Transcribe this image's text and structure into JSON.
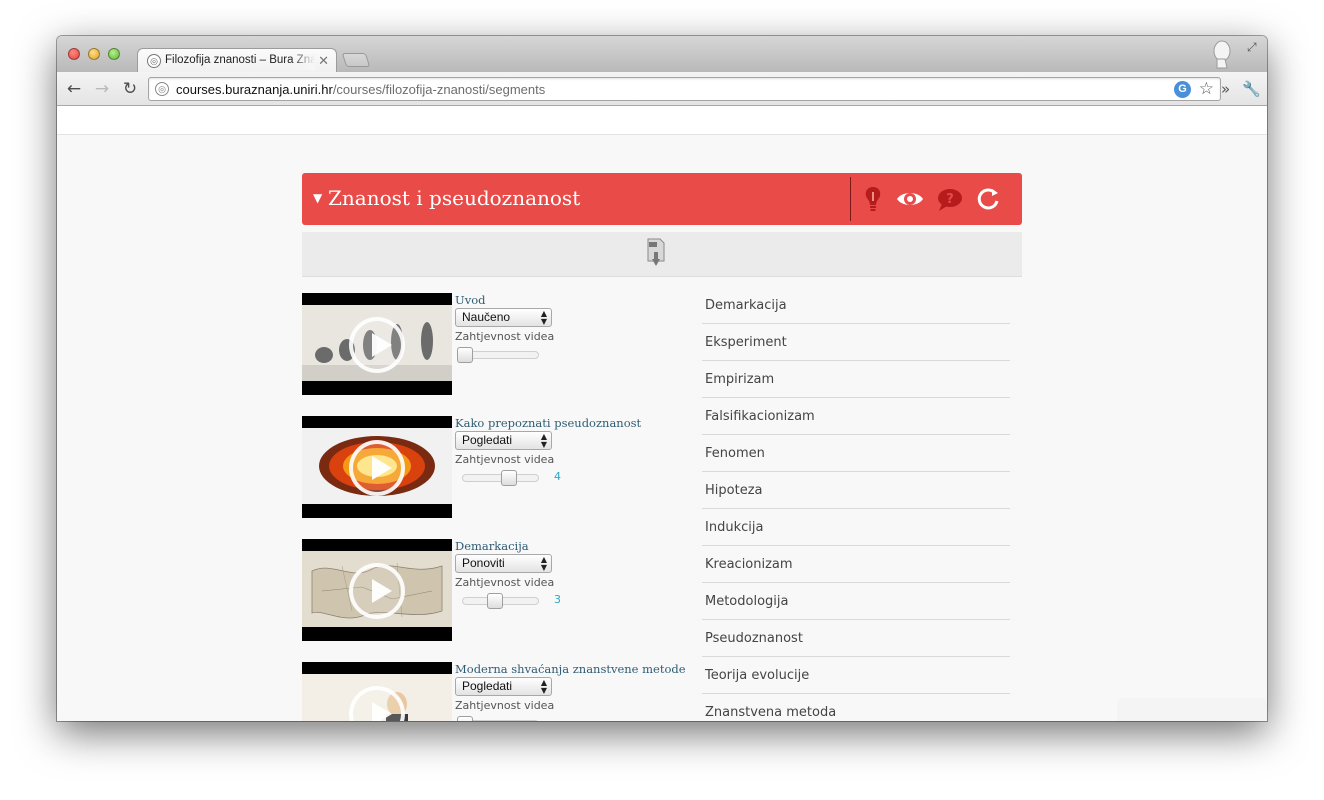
{
  "browser": {
    "tab_title": "Filozofija znanosti – Bura Znanja",
    "url_host": "courses.buraznanja.uniri.hr",
    "url_path": "/courses/filozofija-znanosti/segments",
    "back_glyph": "←",
    "forward_glyph": "→",
    "reload_glyph": "↻",
    "close_glyph": "✕",
    "more_glyph": "»",
    "wrench_glyph": "🔧",
    "star_glyph": "☆",
    "google_glyph": "G",
    "fullscreen_glyph": "⤢"
  },
  "segment": {
    "title": "Znanost i pseudoznanost",
    "caret": "▼",
    "header_color": "#e84b48",
    "header_icons": [
      "lightbulb-icon",
      "eye-icon",
      "question-bubble-icon",
      "refresh-icon"
    ]
  },
  "videos": [
    {
      "title": "Uvod",
      "status": "Naučeno",
      "difficulty_label": "Zahtjevnost videa",
      "difficulty_value": "",
      "difficulty_level": 0.0,
      "thumb": "evolution"
    },
    {
      "title": "Kako prepoznati pseudoznanost",
      "status": "Pogledati",
      "difficulty_label": "Zahtjevnost videa",
      "difficulty_value": "4",
      "difficulty_level": 0.75,
      "thumb": "explosion"
    },
    {
      "title": "Demarkacija",
      "status": "Ponoviti",
      "difficulty_label": "Zahtjevnost videa",
      "difficulty_value": "3",
      "difficulty_level": 0.5,
      "thumb": "map"
    },
    {
      "title": "Moderna shvaćanja znanstvene metode",
      "status": "Pogledati",
      "difficulty_label": "Zahtjevnost videa",
      "difficulty_value": "",
      "difficulty_level": 0.0,
      "thumb": "cartoon"
    }
  ],
  "glossary": [
    "Demarkacija",
    "Eksperiment",
    "Empirizam",
    "Falsifikacionizam",
    "Fenomen",
    "Hipoteza",
    "Indukcija",
    "Kreacionizam",
    "Metodologija",
    "Pseudoznanost",
    "Teorija evolucije",
    "Znanstvena metoda"
  ],
  "colors": {
    "accent": "#e84b48",
    "link": "#2e5c74",
    "value": "#2ea6c0"
  }
}
